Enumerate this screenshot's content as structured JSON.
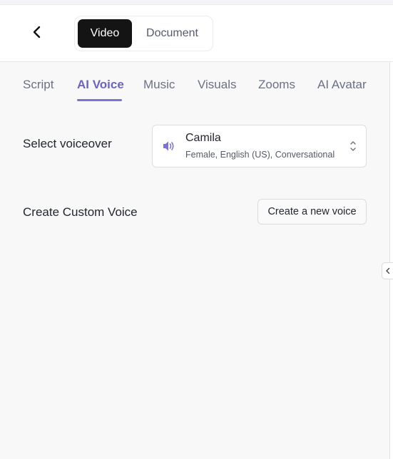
{
  "header": {
    "back_icon": "chevron-left-icon",
    "mode_toggle": {
      "options": [
        {
          "label": "Video",
          "selected": true
        },
        {
          "label": "Document",
          "selected": false
        }
      ]
    }
  },
  "tabs": {
    "items": [
      {
        "label": "Script"
      },
      {
        "label": "AI Voice",
        "active": true
      },
      {
        "label": "Music"
      },
      {
        "label": "Visuals"
      },
      {
        "label": "Zooms"
      },
      {
        "label": "AI Avatar"
      }
    ],
    "accent_color": "#6b64c6"
  },
  "voiceover": {
    "label": "Select voiceover",
    "selected_voice": {
      "name": "Camila",
      "description": "Female, English (US), Conversational",
      "icon": "speaker-icon"
    },
    "control_icon": "chevron-up-down-icon"
  },
  "custom_voice": {
    "label": "Create Custom Voice",
    "button_label": "Create a new voice"
  },
  "side_panel": {
    "collapse_icon": "chevron-left-icon"
  }
}
